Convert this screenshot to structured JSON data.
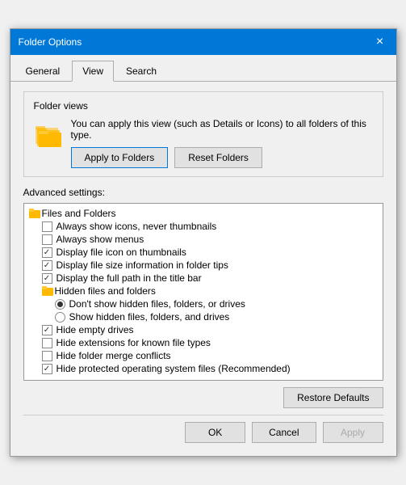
{
  "dialog": {
    "title": "Folder Options",
    "close_button": "×"
  },
  "tabs": [
    {
      "label": "General",
      "active": false
    },
    {
      "label": "View",
      "active": true
    },
    {
      "label": "Search",
      "active": false
    }
  ],
  "folder_views": {
    "section_label": "Folder views",
    "description": "You can apply this view (such as Details or Icons) to all folders of this type.",
    "apply_button": "Apply to Folders",
    "reset_button": "Reset Folders"
  },
  "advanced": {
    "label": "Advanced settings:",
    "items": [
      {
        "type": "folder",
        "label": "Files and Folders",
        "indent": 0
      },
      {
        "type": "checkbox",
        "checked": false,
        "label": "Always show icons, never thumbnails",
        "indent": 1
      },
      {
        "type": "checkbox",
        "checked": false,
        "label": "Always show menus",
        "indent": 1
      },
      {
        "type": "checkbox",
        "checked": true,
        "label": "Display file icon on thumbnails",
        "indent": 1
      },
      {
        "type": "checkbox",
        "checked": true,
        "label": "Display file size information in folder tips",
        "indent": 1
      },
      {
        "type": "checkbox",
        "checked": true,
        "label": "Display the full path in the title bar",
        "indent": 1
      },
      {
        "type": "folder",
        "label": "Hidden files and folders",
        "indent": 1
      },
      {
        "type": "radio",
        "checked": true,
        "label": "Don't show hidden files, folders, or drives",
        "indent": 2
      },
      {
        "type": "radio",
        "checked": false,
        "label": "Show hidden files, folders, and drives",
        "indent": 2
      },
      {
        "type": "checkbox",
        "checked": true,
        "label": "Hide empty drives",
        "indent": 1
      },
      {
        "type": "checkbox",
        "checked": false,
        "label": "Hide extensions for known file types",
        "indent": 1
      },
      {
        "type": "checkbox",
        "checked": false,
        "label": "Hide folder merge conflicts",
        "indent": 1
      },
      {
        "type": "checkbox",
        "checked": true,
        "label": "Hide protected operating system files (Recommended)",
        "indent": 1
      }
    ],
    "restore_defaults": "Restore Defaults"
  },
  "footer": {
    "ok": "OK",
    "cancel": "Cancel",
    "apply": "Apply"
  }
}
